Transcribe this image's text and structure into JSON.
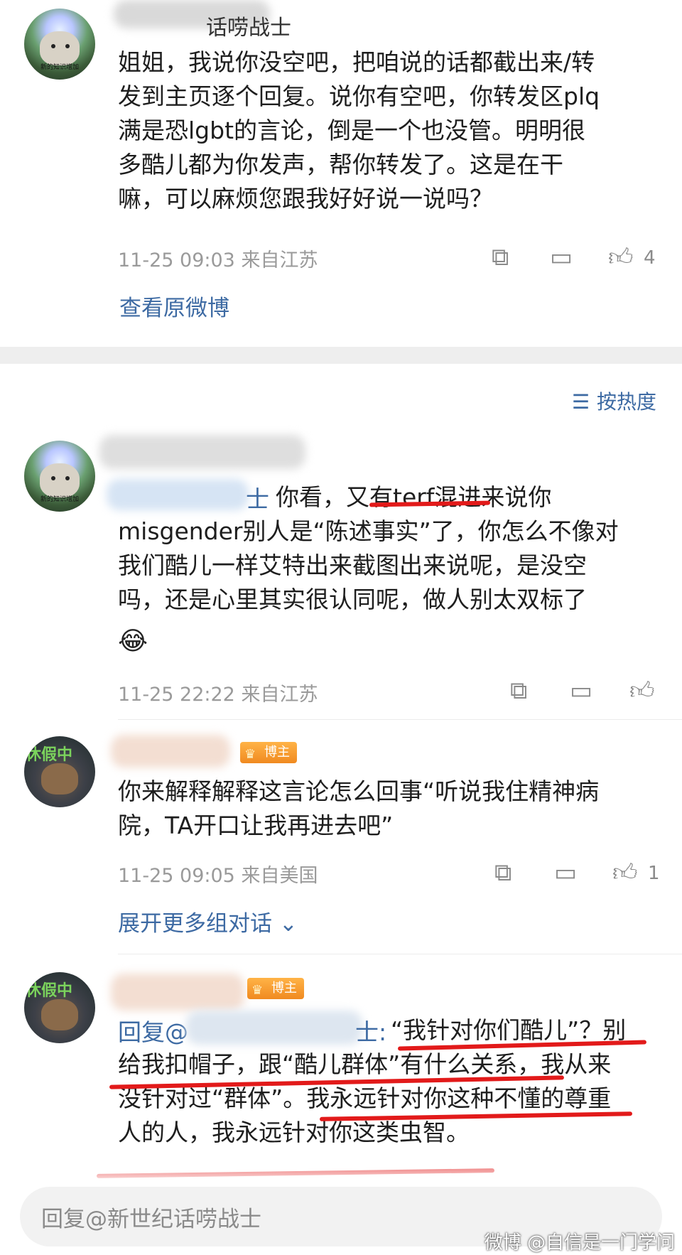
{
  "comments": [
    {
      "text": "姐姐，我说你没空吧，把咱说的话都截出来/转\n发到主页逐个回复。说你有空吧，你转发区plq\n满是恐lgbt的言论，倒是一个也没管。明明很\n多酷儿都为你发声，帮你转发了。这是在干\n嘛，可以麻烦您跟我好好说一说吗？",
      "time": "11-25 09:03",
      "location": "来自江苏",
      "likes": "4",
      "link": "查看原微博"
    },
    {
      "text_tail": "你看，又有terf混进来说你\nmisgender别人是“陈述事实”了，你怎么不像对\n我们酷儿一样艾特出来截图出来说呢，是没空\n吗，还是心里其实很认同呢，做人别太双标了",
      "emoji": "😂",
      "time": "11-25 22:22",
      "location": "来自江苏",
      "username_suffix": "士"
    },
    {
      "text": "你来解释解释这言论怎么回事“听说我住精神病\n院，TA开口让我再进去吧”",
      "time": "11-25 09:05",
      "location": "来自美国",
      "likes": "1",
      "link": "展开更多组对话",
      "badge": "博主",
      "avatar_tag": "休假中"
    },
    {
      "prefix": "回复@",
      "name_suffix": "士:",
      "text_rest": "“我针对你们酷儿”？别\n给我扣帽子，跟“酷儿群体”有什么关系，我从来\n没针对过“群体”。我永远针对你这种不懂的尊重\n人的人，我永远针对你这类虫智。",
      "badge": "博主",
      "avatar_tag": "休假中"
    }
  ],
  "header_fragment": "话唠战士",
  "sort_label": "按热度",
  "reply_placeholder": "回复@新世纪话唠战士",
  "watermark": "微博 @自信是一门学问",
  "avatar_caption": "新的知识增加",
  "icons": [
    "share-icon",
    "comment-icon",
    "like-icon",
    "sort-icon",
    "chevron-down-icon",
    "crown-icon"
  ],
  "colors": {
    "link": "#3d6aa3",
    "meta": "#9a9a9a",
    "underline": "#e21a1a",
    "badge": "#f08a20"
  }
}
